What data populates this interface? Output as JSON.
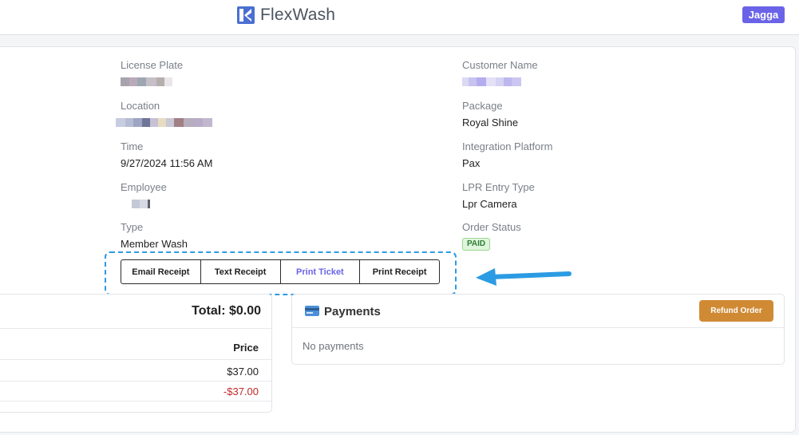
{
  "header": {
    "brand_name": "FlexWash",
    "user_badge": "Jagga"
  },
  "order": {
    "left_fields": [
      {
        "label": "License Plate",
        "value": null
      },
      {
        "label": "Location",
        "value": null
      },
      {
        "label": "Time",
        "value": "9/27/2024 11:56 AM"
      },
      {
        "label": "Employee",
        "value": null
      },
      {
        "label": "Type",
        "value": "Member Wash"
      }
    ],
    "right_fields": [
      {
        "label": "Customer Name",
        "value": null
      },
      {
        "label": "Package",
        "value": "Royal Shine"
      },
      {
        "label": "Integration Platform",
        "value": "Pax"
      },
      {
        "label": "LPR Entry Type",
        "value": "Lpr Camera"
      },
      {
        "label": "Order Status",
        "value": "PAID"
      }
    ],
    "actions": [
      "Email Receipt",
      "Text Receipt",
      "Print Ticket",
      "Print Receipt"
    ],
    "active_action": "Print Ticket"
  },
  "items": {
    "total": "Total: $0.00",
    "price_header": "Price",
    "prices": [
      "$37.00",
      "-$37.00"
    ]
  },
  "payments": {
    "title": "Payments",
    "refund_label": "Refund Order",
    "empty_text": "No payments"
  },
  "colors": {
    "accent": "#6a63e8",
    "highlight": "#2b9be3",
    "refund": "#d08a34",
    "negative": "#c62828",
    "paid_bg": "#dff6dc"
  }
}
